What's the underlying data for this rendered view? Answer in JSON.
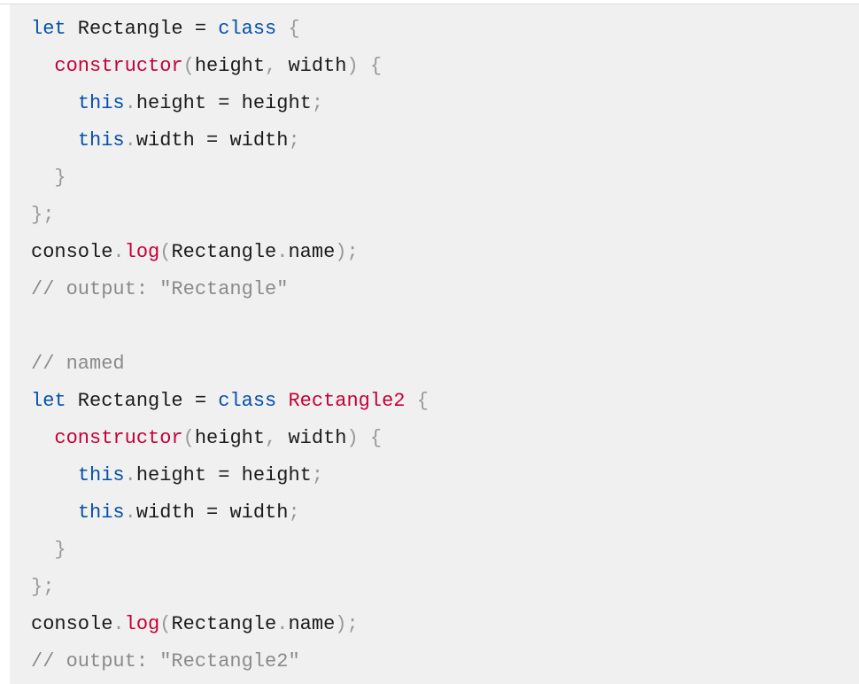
{
  "code": {
    "lines": [
      [
        {
          "t": "let",
          "c": "keyword"
        },
        {
          "t": " Rectangle ",
          "c": "plain"
        },
        {
          "t": "=",
          "c": "plain"
        },
        {
          "t": " ",
          "c": "plain"
        },
        {
          "t": "class",
          "c": "keyword"
        },
        {
          "t": " ",
          "c": "plain"
        },
        {
          "t": "{",
          "c": "punct"
        }
      ],
      [
        {
          "t": "  ",
          "c": "plain"
        },
        {
          "t": "constructor",
          "c": "func"
        },
        {
          "t": "(",
          "c": "punct"
        },
        {
          "t": "height",
          "c": "plain"
        },
        {
          "t": ",",
          "c": "punct"
        },
        {
          "t": " width",
          "c": "plain"
        },
        {
          "t": ")",
          "c": "punct"
        },
        {
          "t": " ",
          "c": "plain"
        },
        {
          "t": "{",
          "c": "punct"
        }
      ],
      [
        {
          "t": "    ",
          "c": "plain"
        },
        {
          "t": "this",
          "c": "keyword"
        },
        {
          "t": ".",
          "c": "punct"
        },
        {
          "t": "height ",
          "c": "plain"
        },
        {
          "t": "=",
          "c": "plain"
        },
        {
          "t": " height",
          "c": "plain"
        },
        {
          "t": ";",
          "c": "punct"
        }
      ],
      [
        {
          "t": "    ",
          "c": "plain"
        },
        {
          "t": "this",
          "c": "keyword"
        },
        {
          "t": ".",
          "c": "punct"
        },
        {
          "t": "width ",
          "c": "plain"
        },
        {
          "t": "=",
          "c": "plain"
        },
        {
          "t": " width",
          "c": "plain"
        },
        {
          "t": ";",
          "c": "punct"
        }
      ],
      [
        {
          "t": "  ",
          "c": "plain"
        },
        {
          "t": "}",
          "c": "punct"
        }
      ],
      [
        {
          "t": "}",
          "c": "punct"
        },
        {
          "t": ";",
          "c": "punct"
        }
      ],
      [
        {
          "t": "console",
          "c": "plain"
        },
        {
          "t": ".",
          "c": "punct"
        },
        {
          "t": "log",
          "c": "func"
        },
        {
          "t": "(",
          "c": "punct"
        },
        {
          "t": "Rectangle",
          "c": "plain"
        },
        {
          "t": ".",
          "c": "punct"
        },
        {
          "t": "name",
          "c": "plain"
        },
        {
          "t": ")",
          "c": "punct"
        },
        {
          "t": ";",
          "c": "punct"
        }
      ],
      [
        {
          "t": "// output: \"Rectangle\"",
          "c": "comment"
        }
      ],
      [],
      [
        {
          "t": "// named",
          "c": "comment"
        }
      ],
      [
        {
          "t": "let",
          "c": "keyword"
        },
        {
          "t": " Rectangle ",
          "c": "plain"
        },
        {
          "t": "=",
          "c": "plain"
        },
        {
          "t": " ",
          "c": "plain"
        },
        {
          "t": "class",
          "c": "keyword"
        },
        {
          "t": " ",
          "c": "plain"
        },
        {
          "t": "Rectangle2",
          "c": "class"
        },
        {
          "t": " ",
          "c": "plain"
        },
        {
          "t": "{",
          "c": "punct"
        }
      ],
      [
        {
          "t": "  ",
          "c": "plain"
        },
        {
          "t": "constructor",
          "c": "func"
        },
        {
          "t": "(",
          "c": "punct"
        },
        {
          "t": "height",
          "c": "plain"
        },
        {
          "t": ",",
          "c": "punct"
        },
        {
          "t": " width",
          "c": "plain"
        },
        {
          "t": ")",
          "c": "punct"
        },
        {
          "t": " ",
          "c": "plain"
        },
        {
          "t": "{",
          "c": "punct"
        }
      ],
      [
        {
          "t": "    ",
          "c": "plain"
        },
        {
          "t": "this",
          "c": "keyword"
        },
        {
          "t": ".",
          "c": "punct"
        },
        {
          "t": "height ",
          "c": "plain"
        },
        {
          "t": "=",
          "c": "plain"
        },
        {
          "t": " height",
          "c": "plain"
        },
        {
          "t": ";",
          "c": "punct"
        }
      ],
      [
        {
          "t": "    ",
          "c": "plain"
        },
        {
          "t": "this",
          "c": "keyword"
        },
        {
          "t": ".",
          "c": "punct"
        },
        {
          "t": "width ",
          "c": "plain"
        },
        {
          "t": "=",
          "c": "plain"
        },
        {
          "t": " width",
          "c": "plain"
        },
        {
          "t": ";",
          "c": "punct"
        }
      ],
      [
        {
          "t": "  ",
          "c": "plain"
        },
        {
          "t": "}",
          "c": "punct"
        }
      ],
      [
        {
          "t": "}",
          "c": "punct"
        },
        {
          "t": ";",
          "c": "punct"
        }
      ],
      [
        {
          "t": "console",
          "c": "plain"
        },
        {
          "t": ".",
          "c": "punct"
        },
        {
          "t": "log",
          "c": "func"
        },
        {
          "t": "(",
          "c": "punct"
        },
        {
          "t": "Rectangle",
          "c": "plain"
        },
        {
          "t": ".",
          "c": "punct"
        },
        {
          "t": "name",
          "c": "plain"
        },
        {
          "t": ")",
          "c": "punct"
        },
        {
          "t": ";",
          "c": "punct"
        }
      ],
      [
        {
          "t": "// output: \"Rectangle2\"",
          "c": "comment"
        }
      ]
    ]
  },
  "colors": {
    "background": "#f0f0f0",
    "keyword": "#0550ae",
    "function": "#c6003a",
    "punctuation": "#999999",
    "comment": "#8a8a8a",
    "text": "#1b1b1b"
  }
}
